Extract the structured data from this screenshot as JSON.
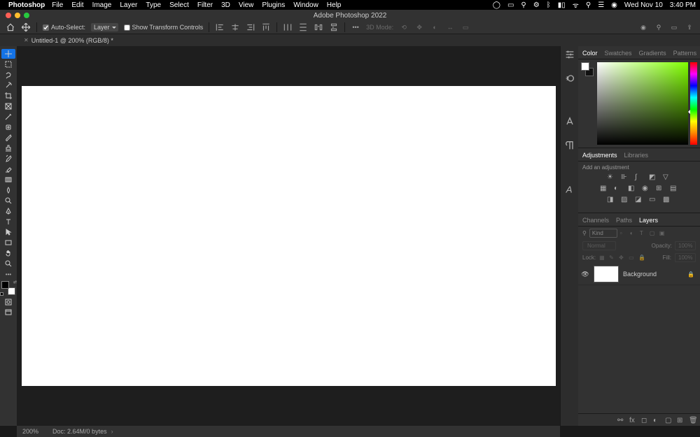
{
  "menubar": {
    "apple": "",
    "app": "Photoshop",
    "items": [
      "File",
      "Edit",
      "Image",
      "Layer",
      "Type",
      "Select",
      "Filter",
      "3D",
      "View",
      "Plugins",
      "Window",
      "Help"
    ],
    "status_date": "Wed Nov 10",
    "status_time": "3:40 PM"
  },
  "titlebar": {
    "title": "Adobe Photoshop 2022"
  },
  "optionsbar": {
    "auto_select": "Auto-Select:",
    "auto_select_target": "Layer",
    "show_transform": "Show Transform Controls",
    "mode3d": "3D Mode:"
  },
  "doctab": {
    "name": "Untitled-1 @ 200% (RGB/8) *"
  },
  "panels": {
    "color_tabs": [
      "Color",
      "Swatches",
      "Gradients",
      "Patterns"
    ],
    "adj_tabs": [
      "Adjustments",
      "Libraries"
    ],
    "adj_label": "Add an adjustment",
    "layer_tabs": [
      "Channels",
      "Paths",
      "Layers"
    ],
    "layer_search_label": "Kind",
    "blend_mode": "Normal",
    "opacity_label": "Opacity:",
    "opacity_value": "100%",
    "lock_label": "Lock:",
    "fill_label": "Fill:",
    "fill_value": "100%",
    "layers": [
      {
        "name": "Background",
        "visible": true,
        "locked": true
      }
    ]
  },
  "statusbar": {
    "zoom": "200%",
    "doc_info": "Doc: 2.64M/0 bytes"
  }
}
